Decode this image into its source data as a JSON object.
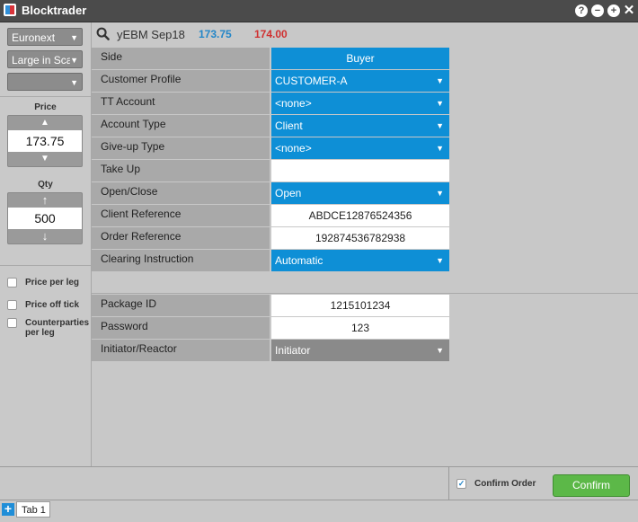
{
  "app": {
    "title": "Blocktrader"
  },
  "window_controls": {
    "help": "?",
    "minimize": "−",
    "maximize": "+",
    "close": "✕"
  },
  "left_panel": {
    "exchange_select": "Euronext",
    "type_select": "Large in Sca",
    "third_select": "",
    "price_label": "Price",
    "price_value": "173.75",
    "qty_label": "Qty",
    "qty_value": "500",
    "checkboxes": [
      {
        "label": "Price per leg",
        "checked": false
      },
      {
        "label": "Price off tick",
        "checked": false
      },
      {
        "label": "Counterparties per leg",
        "checked": false
      }
    ]
  },
  "instrument": {
    "name": "yEBM Sep18",
    "bid": "173.75",
    "ask": "174.00"
  },
  "form_rows": [
    {
      "label": "Side",
      "value": "Buyer",
      "kind": "blue-center"
    },
    {
      "label": "Customer Profile",
      "value": "CUSTOMER-A",
      "kind": "blue-dropdown"
    },
    {
      "label": "TT Account",
      "value": "<none>",
      "kind": "blue-dropdown"
    },
    {
      "label": "Account Type",
      "value": "Client",
      "kind": "blue-dropdown"
    },
    {
      "label": "Give-up Type",
      "value": "<none>",
      "kind": "blue-dropdown"
    },
    {
      "label": "Take Up",
      "value": "",
      "kind": "white"
    },
    {
      "label": "Open/Close",
      "value": "Open",
      "kind": "blue-dropdown"
    },
    {
      "label": "Client Reference",
      "value": "ABDCE12876524356",
      "kind": "white"
    },
    {
      "label": "Order Reference",
      "value": "192874536782938",
      "kind": "white"
    },
    {
      "label": "Clearing Instruction",
      "value": "Automatic",
      "kind": "blue-dropdown"
    }
  ],
  "package_rows": [
    {
      "label": "Package ID",
      "value": "1215101234",
      "kind": "white"
    },
    {
      "label": "Password",
      "value": "123",
      "kind": "white"
    },
    {
      "label": "Initiator/Reactor",
      "value": "Initiator",
      "kind": "gray-dropdown"
    }
  ],
  "bottom": {
    "confirm_order_label": "Confirm Order",
    "confirm_order_checked": true,
    "confirm_button": "Confirm"
  },
  "tabs": {
    "add": "+",
    "items": [
      "Tab 1"
    ]
  },
  "colors": {
    "accent_blue": "#0e8fd6",
    "bid": "#2386c8",
    "ask": "#d03030",
    "confirm_green": "#5cb848"
  }
}
